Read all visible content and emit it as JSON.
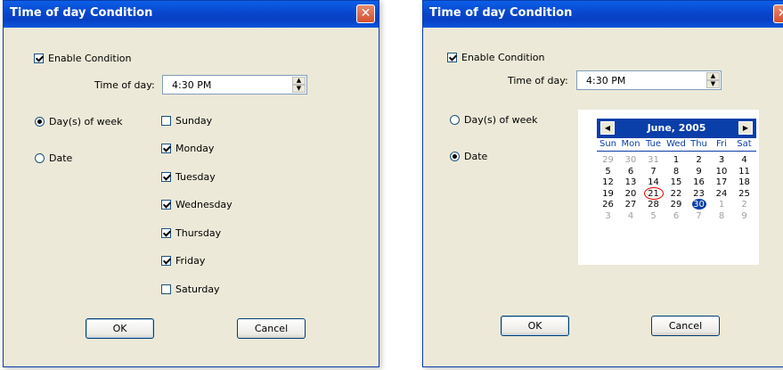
{
  "dialog1": {
    "title": "Time of day Condition",
    "close_glyph": "✕",
    "enable_label": "Enable Condition",
    "time_label": "Time of day:",
    "time_value": "4:30 PM",
    "radio_days_label": "Day(s) of week",
    "radio_date_label": "Date",
    "weekdays": [
      {
        "label": "Sunday",
        "checked": false
      },
      {
        "label": "Monday",
        "checked": true
      },
      {
        "label": "Tuesday",
        "checked": true
      },
      {
        "label": "Wednesday",
        "checked": true
      },
      {
        "label": "Thursday",
        "checked": true
      },
      {
        "label": "Friday",
        "checked": true
      },
      {
        "label": "Saturday",
        "checked": false
      }
    ],
    "ok_label": "OK",
    "cancel_label": "Cancel"
  },
  "dialog2": {
    "title": "Time of day Condition",
    "enable_label": "Enable Condition",
    "time_label": "Time of day:",
    "time_value": "4:30 PM",
    "radio_days_label": "Day(s) of week",
    "radio_date_label": "Date",
    "ok_label": "OK",
    "cancel_label": "Cancel",
    "calendar": {
      "month_label": "June, 2005",
      "prev_glyph": "◀",
      "next_glyph": "▶",
      "days_of_week": [
        "Sun",
        "Mon",
        "Tue",
        "Wed",
        "Thu",
        "Fri",
        "Sat"
      ],
      "weeks": [
        [
          {
            "d": "29",
            "other": true
          },
          {
            "d": "30",
            "other": true
          },
          {
            "d": "31",
            "other": true
          },
          {
            "d": "1"
          },
          {
            "d": "2"
          },
          {
            "d": "3"
          },
          {
            "d": "4"
          }
        ],
        [
          {
            "d": "5"
          },
          {
            "d": "6"
          },
          {
            "d": "7"
          },
          {
            "d": "8"
          },
          {
            "d": "9"
          },
          {
            "d": "10"
          },
          {
            "d": "11"
          }
        ],
        [
          {
            "d": "12"
          },
          {
            "d": "13"
          },
          {
            "d": "14"
          },
          {
            "d": "15"
          },
          {
            "d": "16"
          },
          {
            "d": "17"
          },
          {
            "d": "18"
          }
        ],
        [
          {
            "d": "19"
          },
          {
            "d": "20"
          },
          {
            "d": "21",
            "today": true
          },
          {
            "d": "22"
          },
          {
            "d": "23"
          },
          {
            "d": "24"
          },
          {
            "d": "25"
          }
        ],
        [
          {
            "d": "26"
          },
          {
            "d": "27"
          },
          {
            "d": "28"
          },
          {
            "d": "29"
          },
          {
            "d": "30",
            "selected": true
          },
          {
            "d": "1",
            "other": true
          },
          {
            "d": "2",
            "other": true
          }
        ],
        [
          {
            "d": "3",
            "other": true
          },
          {
            "d": "4",
            "other": true
          },
          {
            "d": "5",
            "other": true
          },
          {
            "d": "6",
            "other": true
          },
          {
            "d": "7",
            "other": true
          },
          {
            "d": "8",
            "other": true
          },
          {
            "d": "9",
            "other": true
          }
        ]
      ]
    }
  }
}
